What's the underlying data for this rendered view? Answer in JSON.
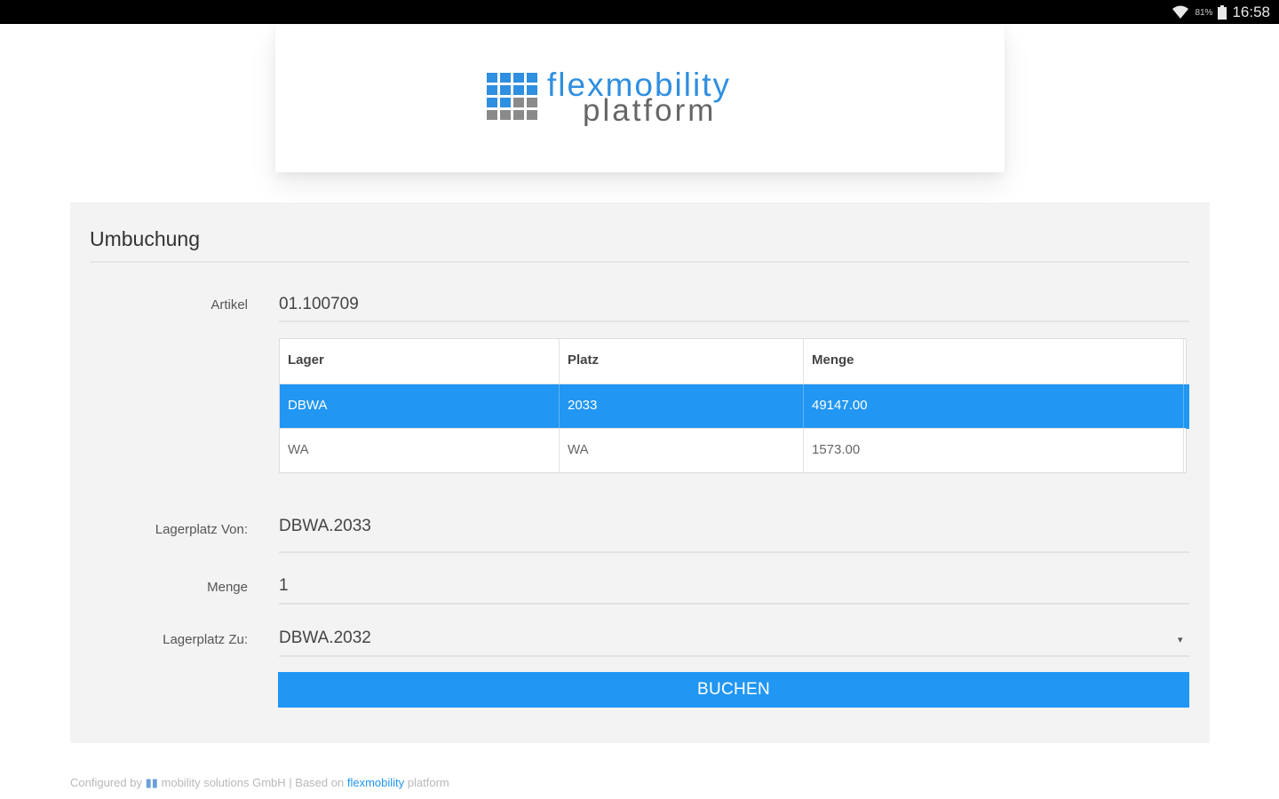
{
  "status_bar": {
    "battery_percent": "81%",
    "time": "16:58",
    "icons": [
      "wifi-icon",
      "battery-icon"
    ]
  },
  "header": {
    "logo_line1": "flexmobility",
    "logo_line2": "platform"
  },
  "form": {
    "title": "Umbuchung",
    "artikel_label": "Artikel",
    "artikel_value": "01.100709",
    "table": {
      "columns": [
        "Lager",
        "Platz",
        "Menge"
      ],
      "rows": [
        {
          "lager": "DBWA",
          "platz": "2033",
          "menge": "49147.00",
          "selected": true
        },
        {
          "lager": "WA",
          "platz": "WA",
          "menge": "1573.00",
          "selected": false
        }
      ]
    },
    "lagerplatz_von_label": "Lagerplatz Von:",
    "lagerplatz_von_value": "DBWA.2033",
    "menge_label": "Menge",
    "menge_value": "1",
    "lagerplatz_zu_label": "Lagerplatz Zu:",
    "lagerplatz_zu_value": "DBWA.2032",
    "submit_label": "BUCHEN"
  },
  "footer": {
    "configured_by": "Configured by",
    "company": "mobility solutions GmbH | Based on",
    "brand": "flexmobility",
    "suffix": "platform"
  },
  "colors": {
    "accent": "#2196f3",
    "panel_bg": "#f3f3f3",
    "status_bar": "#000000",
    "logo_grid_blue": "#2f8fe0",
    "logo_grid_gray": "#8a8a8a",
    "logo_text_blue": "#2f8fe0",
    "logo_text_gray": "#666666"
  }
}
